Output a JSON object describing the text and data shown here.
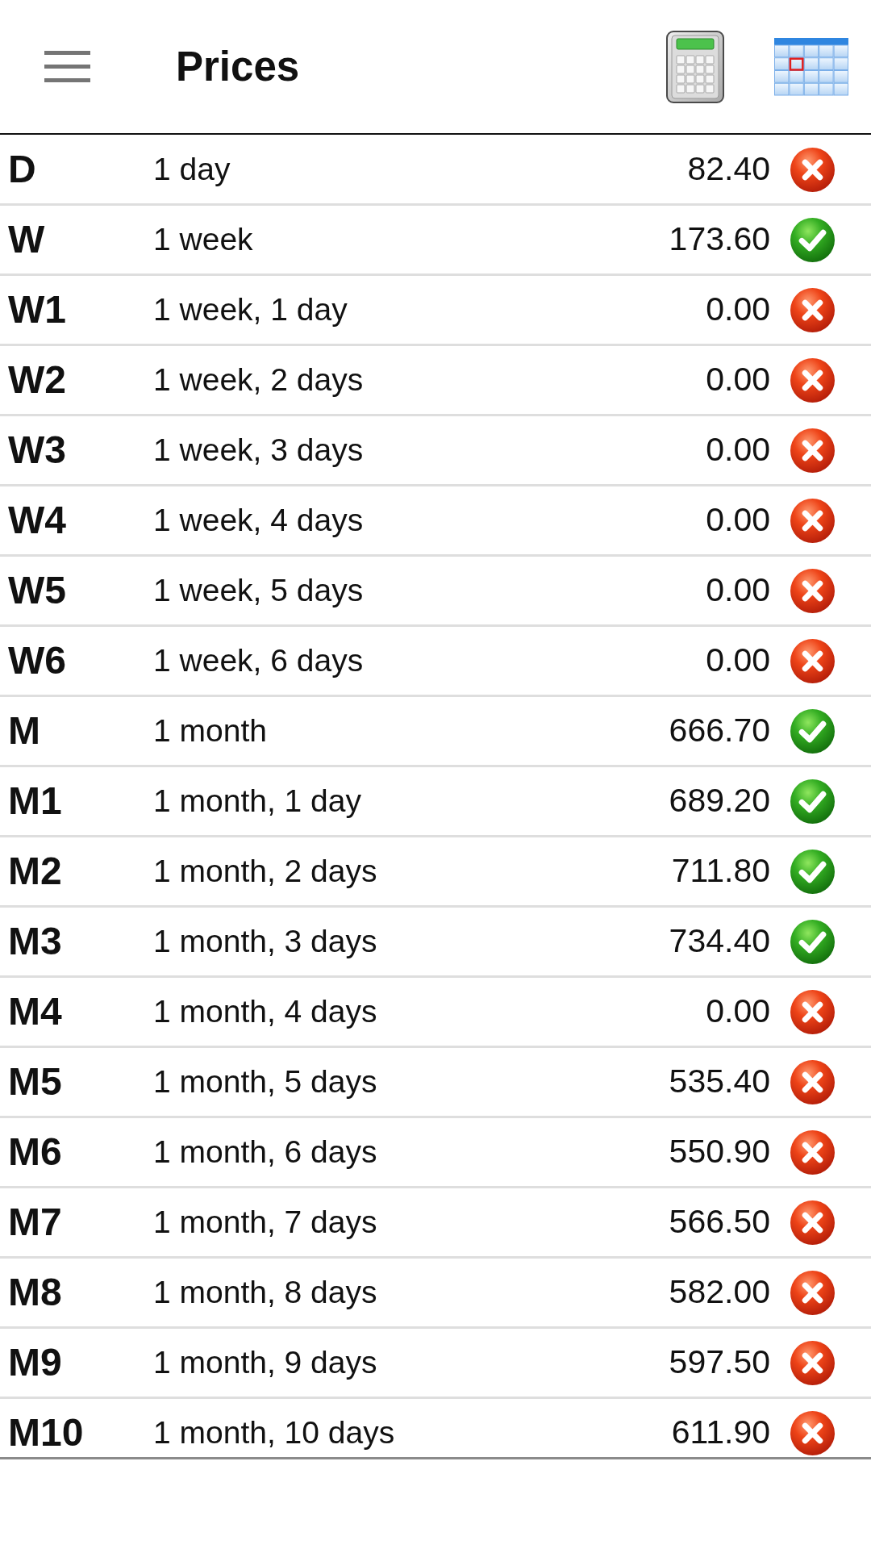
{
  "app_bar": {
    "title": "Prices"
  },
  "prices": [
    {
      "code": "D",
      "duration": "1 day",
      "price": "82.40",
      "active": false
    },
    {
      "code": "W",
      "duration": "1 week",
      "price": "173.60",
      "active": true
    },
    {
      "code": "W1",
      "duration": "1 week, 1 day",
      "price": "0.00",
      "active": false
    },
    {
      "code": "W2",
      "duration": "1 week, 2 days",
      "price": "0.00",
      "active": false
    },
    {
      "code": "W3",
      "duration": "1 week, 3 days",
      "price": "0.00",
      "active": false
    },
    {
      "code": "W4",
      "duration": "1 week, 4 days",
      "price": "0.00",
      "active": false
    },
    {
      "code": "W5",
      "duration": "1 week, 5 days",
      "price": "0.00",
      "active": false
    },
    {
      "code": "W6",
      "duration": "1 week, 6 days",
      "price": "0.00",
      "active": false
    },
    {
      "code": "M",
      "duration": "1 month",
      "price": "666.70",
      "active": true
    },
    {
      "code": "M1",
      "duration": "1 month, 1 day",
      "price": "689.20",
      "active": true
    },
    {
      "code": "M2",
      "duration": "1 month, 2 days",
      "price": "711.80",
      "active": true
    },
    {
      "code": "M3",
      "duration": "1 month, 3 days",
      "price": "734.40",
      "active": true
    },
    {
      "code": "M4",
      "duration": "1 month, 4 days",
      "price": "0.00",
      "active": false
    },
    {
      "code": "M5",
      "duration": "1 month, 5 days",
      "price": "535.40",
      "active": false
    },
    {
      "code": "M6",
      "duration": "1 month, 6 days",
      "price": "550.90",
      "active": false
    },
    {
      "code": "M7",
      "duration": "1 month, 7 days",
      "price": "566.50",
      "active": false
    },
    {
      "code": "M8",
      "duration": "1 month, 8 days",
      "price": "582.00",
      "active": false
    },
    {
      "code": "M9",
      "duration": "1 month, 9 days",
      "price": "597.50",
      "active": false
    },
    {
      "code": "M10",
      "duration": "1 month, 10 days",
      "price": "611.90",
      "active": false
    }
  ]
}
